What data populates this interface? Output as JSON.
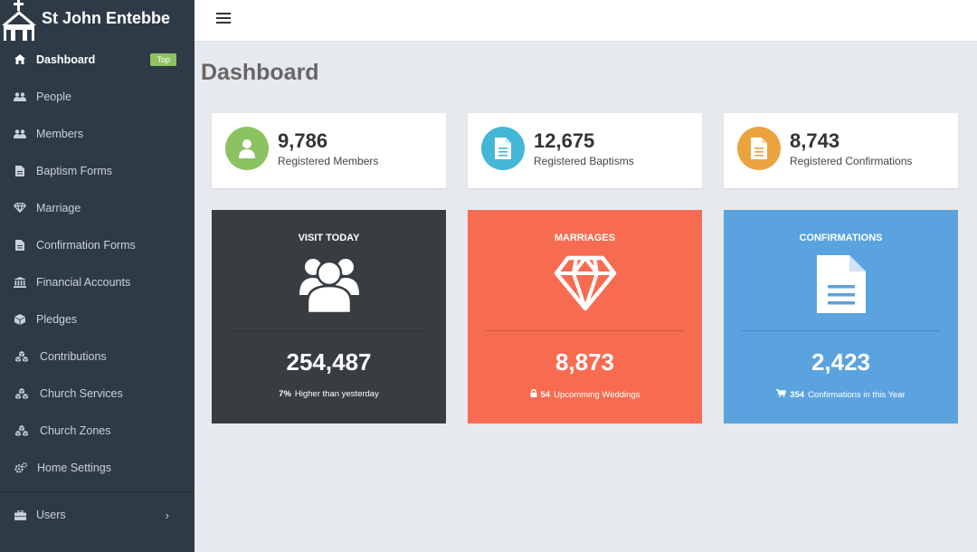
{
  "brand": {
    "title": "St John Entebbe",
    "icon": "church-icon"
  },
  "sidebar": {
    "items": [
      {
        "label": "Dashboard",
        "icon": "home-icon",
        "badge": "Top",
        "active": true
      },
      {
        "label": "People",
        "icon": "users-icon"
      },
      {
        "label": "Members",
        "icon": "users-icon"
      },
      {
        "label": "Baptism Forms",
        "icon": "file-icon"
      },
      {
        "label": "Marriage",
        "icon": "diamond-icon"
      },
      {
        "label": "Confirmation Forms",
        "icon": "file-icon"
      },
      {
        "label": "Financial Accounts",
        "icon": "bank-icon"
      },
      {
        "label": "Pledges",
        "icon": "cube-icon"
      },
      {
        "label": "Contributions",
        "icon": "cubes-icon"
      },
      {
        "label": "Church Services",
        "icon": "cubes-icon"
      },
      {
        "label": "Church Zones",
        "icon": "cubes-icon"
      },
      {
        "label": "Home Settings",
        "icon": "cogs-icon"
      }
    ],
    "users": {
      "label": "Users",
      "icon": "briefcase-icon"
    }
  },
  "header": {
    "menu_icon": "hamburger-icon"
  },
  "page": {
    "title": "Dashboard"
  },
  "stats": [
    {
      "value": "9,786",
      "label": "Registered Members",
      "color": "#8dc263",
      "icon": "user-icon"
    },
    {
      "value": "12,675",
      "label": "Registered Baptisms",
      "color": "#44b6d8",
      "icon": "file-icon"
    },
    {
      "value": "8,743",
      "label": "Registered Confirmations",
      "color": "#eba340",
      "icon": "file-icon"
    }
  ],
  "panels": [
    {
      "title": "VISIT TODAY",
      "value": "254,487",
      "sub_strong": "7%",
      "sub_text": "Higher than yesterday",
      "color": "#383d41",
      "icon": "users-icon"
    },
    {
      "title": "MARRIAGES",
      "value": "8,873",
      "sub_strong": "54",
      "sub_text": "Upcomming Weddings",
      "color": "#f76c51",
      "icon": "diamond-icon",
      "sub_icon": "lock-icon"
    },
    {
      "title": "CONFIRMATIONS",
      "value": "2,423",
      "sub_strong": "354",
      "sub_text": "Confirmations in this Year",
      "color": "#5ba3df",
      "icon": "file-icon",
      "sub_icon": "cart-icon"
    }
  ]
}
